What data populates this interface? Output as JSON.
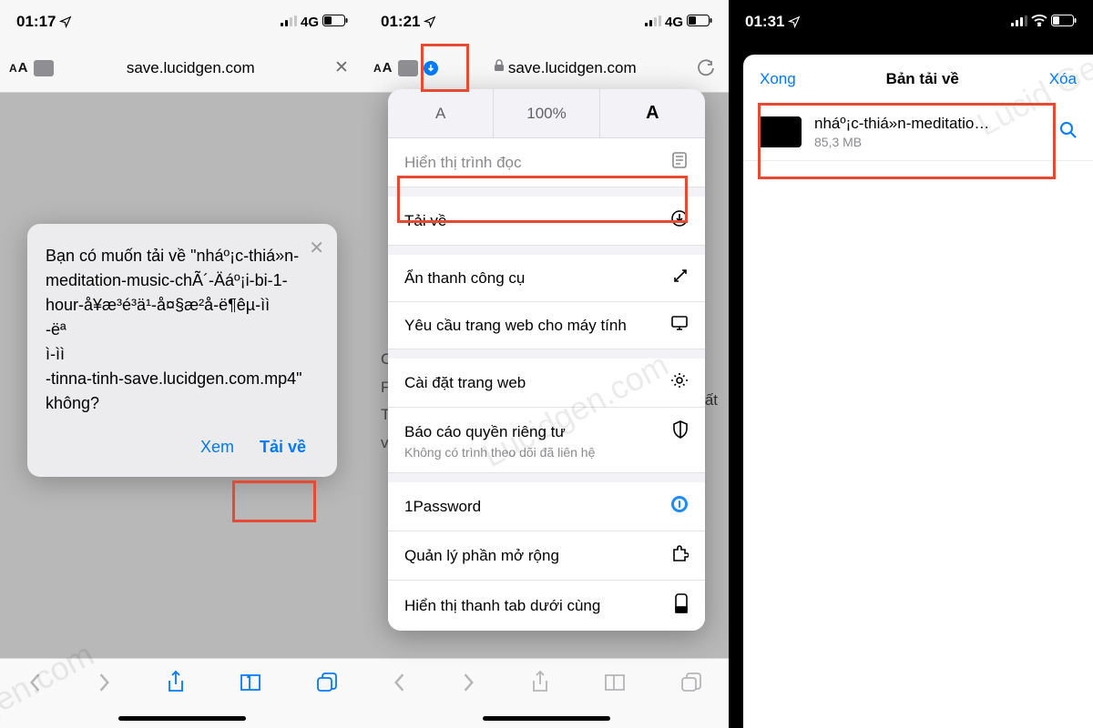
{
  "phone1": {
    "status": {
      "time": "01:17",
      "net": "4G"
    },
    "url": "save.lucidgen.com",
    "dialog": {
      "body": "Bạn có muốn tải về \"nháº¡c-thiá»n-meditation-music-chÃ´-Äáº¡i-bi-1-hour-å¥æ³é³ä¹-å¤§æ²å-ë¶êµ-ìì\n-ëª\nì-ìì\n-tinna-tinh-save.lucidgen.com.mp4\" không?",
      "view": "Xem",
      "download": "Tải về"
    }
  },
  "phone2": {
    "status": {
      "time": "01:21",
      "net": "4G"
    },
    "url": "save.lucidgen.com",
    "zoom": {
      "pct": "100%",
      "smallA": "A",
      "bigA": "A"
    },
    "menu": {
      "reader": "Hiển thị trình đọc",
      "downloads": "Tải về",
      "hideToolbar": "Ẩn thanh công cụ",
      "desktopSite": "Yêu cầu trang web cho máy tính",
      "siteSettings": "Cài đặt trang web",
      "privacyReport": "Báo cáo quyền riêng tư",
      "privacySub": "Không có trình theo dõi đã liên hệ",
      "onepass": "1Password",
      "extensions": "Quản lý phần mở rộng",
      "tabbarBottom": "Hiển thị thanh tab dưới cùng"
    },
    "behindLetters": "C\nF\nT\nv"
  },
  "phone3": {
    "status": {
      "time": "01:31"
    },
    "header": {
      "done": "Xong",
      "title": "Bản tải về",
      "clear": "Xóa"
    },
    "item": {
      "name": "nháº¡c-thiá»n-meditatio…",
      "size": "85,3 MB"
    }
  },
  "peekText": "ất"
}
